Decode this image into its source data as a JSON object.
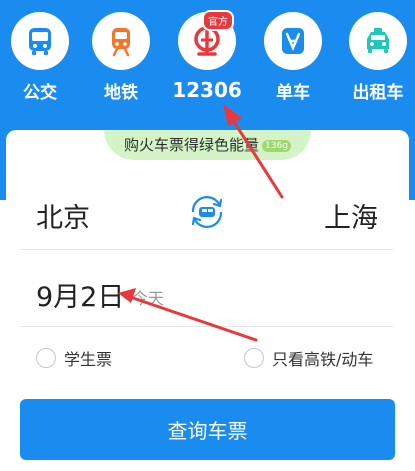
{
  "nav": {
    "items": [
      {
        "label": "公交",
        "icon": "bus-icon",
        "color": "#1a8cf0"
      },
      {
        "label": "地铁",
        "icon": "subway-icon",
        "color": "#f0772a"
      },
      {
        "label": "12306",
        "icon": "railway-logo-icon",
        "color": "#e8383d",
        "badge": "官方"
      },
      {
        "label": "单车",
        "icon": "bike-icon",
        "color": "#1a8cf0"
      },
      {
        "label": "出租车",
        "icon": "taxi-icon",
        "color": "#1fc7b8"
      }
    ]
  },
  "promo": {
    "text": "购火车票得绿色能量",
    "pill": "136g"
  },
  "route": {
    "from": "北京",
    "to": "上海",
    "swap_icon": "swap-train-icon"
  },
  "date": {
    "value": "9月2日",
    "relative": "今天"
  },
  "options": {
    "student": "学生票",
    "high_speed": "只看高铁/动车"
  },
  "query_button": "查询车票",
  "colors": {
    "brand": "#1a8cf0",
    "arrow": "#e8383d"
  }
}
